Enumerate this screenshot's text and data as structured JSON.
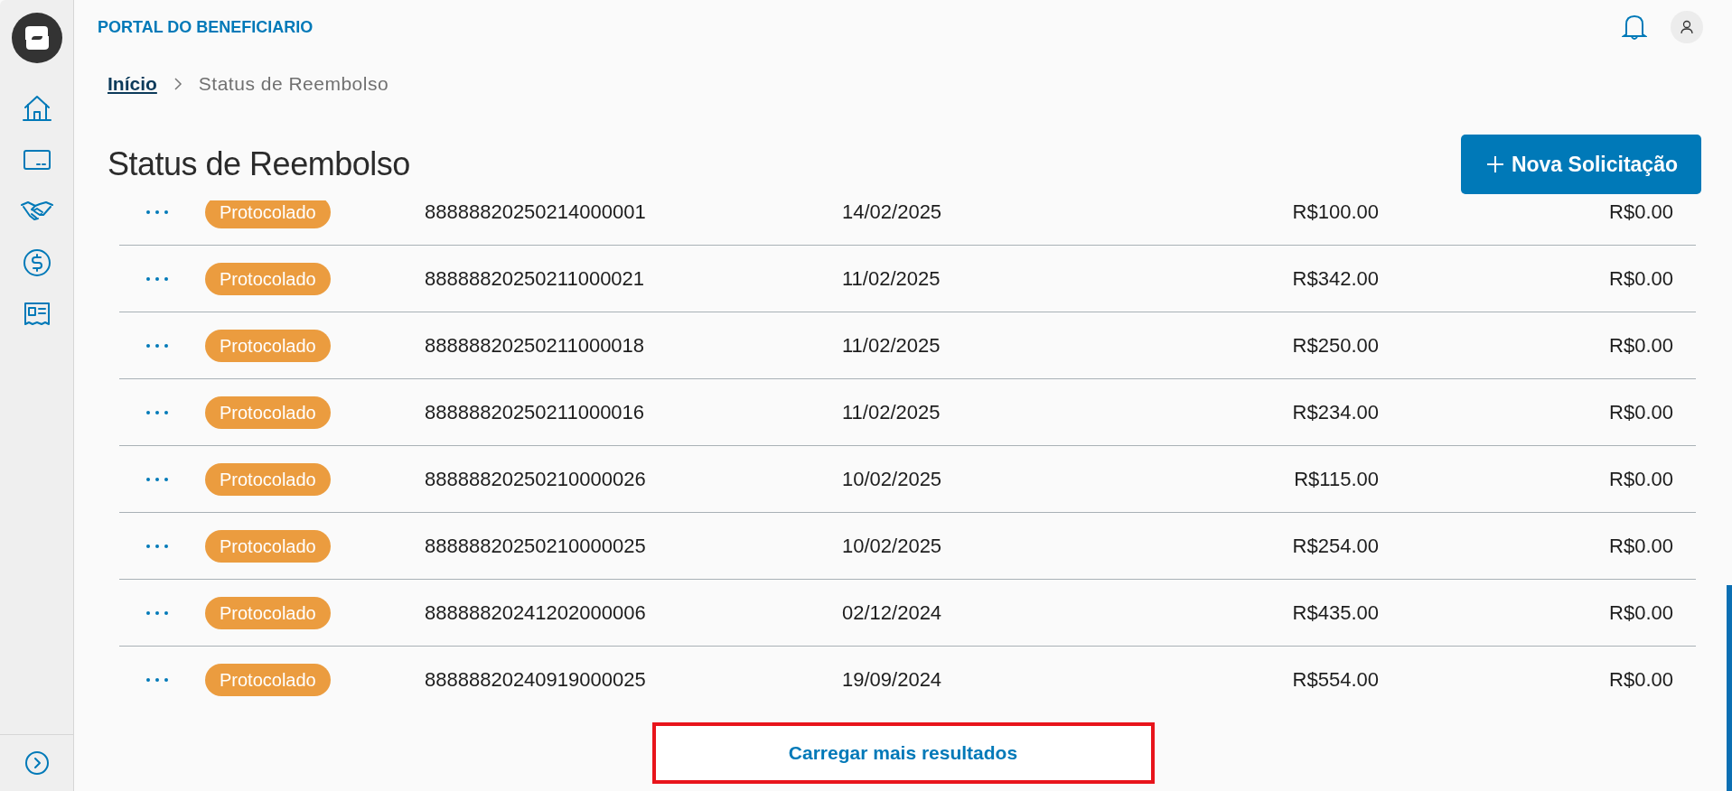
{
  "header": {
    "title": "PORTAL DO BENEFICIARIO"
  },
  "breadcrumb": [
    {
      "label": "Início",
      "kind": "link"
    },
    {
      "label": "Status de Reembolso",
      "kind": "current"
    }
  ],
  "page_title": "Status de Reembolso",
  "new_button": {
    "label": "Nova Solicitação"
  },
  "rows": [
    {
      "status": "Protocolado",
      "color": "#eb9c3f",
      "column_3": "88888820250214000001",
      "column_4": "14/02/2025",
      "column_5": "R$100.00",
      "column_6": "R$0.00"
    },
    {
      "status": "Protocolado",
      "color": "#eb9c3f",
      "column_3": "88888820250211000021",
      "column_4": "11/02/2025",
      "column_5": "R$342.00",
      "column_6": "R$0.00"
    },
    {
      "status": "Protocolado",
      "color": "#eb9c3f",
      "column_3": "88888820250211000018",
      "column_4": "11/02/2025",
      "column_5": "R$250.00",
      "column_6": "R$0.00"
    },
    {
      "status": "Protocolado",
      "color": "#eb9c3f",
      "column_3": "88888820250211000016",
      "column_4": "11/02/2025",
      "column_5": "R$234.00",
      "column_6": "R$0.00"
    },
    {
      "status": "Protocolado",
      "color": "#eb9c3f",
      "column_3": "88888820250210000026",
      "column_4": "10/02/2025",
      "column_5": "R$115.00",
      "column_6": "R$0.00"
    },
    {
      "status": "Protocolado",
      "color": "#eb9c3f",
      "column_3": "88888820250210000025",
      "column_4": "10/02/2025",
      "column_5": "R$254.00",
      "column_6": "R$0.00"
    },
    {
      "status": "Protocolado",
      "color": "#eb9c3f",
      "column_3": "88888820241202000006",
      "column_4": "02/12/2024",
      "column_5": "R$435.00",
      "column_6": "R$0.00"
    },
    {
      "status": "Protocolado",
      "color": "#eb9c3f",
      "column_3": "88888820240919000025",
      "column_4": "19/09/2024",
      "column_5": "R$554.00",
      "column_6": "R$0.00"
    }
  ],
  "load_more": {
    "label": "Carregar mais resultados",
    "highlighted": true
  }
}
